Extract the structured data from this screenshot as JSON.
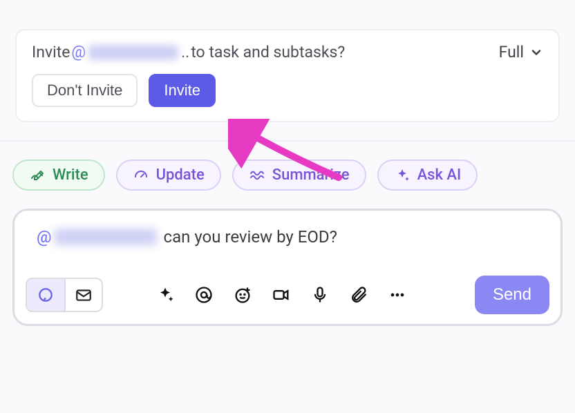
{
  "invite_prompt": {
    "prefix": "Invite ",
    "mention": "@",
    "name": "Brad Dan",
    "ellipsis": "..",
    "suffix": " to task and subtasks?",
    "scope_label": "Full",
    "dont_invite": "Don't Invite",
    "invite": "Invite"
  },
  "chips": {
    "write": "Write",
    "update": "Update",
    "summarize": "Summarize",
    "ask_ai": "Ask AI"
  },
  "composer": {
    "mention": "@",
    "name": "Brad Daniels",
    "text": "can you review by EOD?",
    "send": "Send"
  },
  "icons": {
    "chevron_down": "chevron-down-icon",
    "write": "pencil-write-icon",
    "update": "gauge-icon",
    "summarize": "wave-icon",
    "ask_ai": "sparkle-icon",
    "chat_tab": "chat-bubble-icon",
    "mail_tab": "mail-icon",
    "ai": "sparkle-icon",
    "mention": "mention-icon",
    "emoji": "emoji-plus-icon",
    "video": "video-icon",
    "mic": "mic-icon",
    "attach": "paperclip-icon",
    "more": "more-icon"
  },
  "colors": {
    "primary": "#5b5be7",
    "accent_green": "#2e8b57",
    "accent_purple": "#7653d9",
    "annotation": "#e53ac1"
  }
}
